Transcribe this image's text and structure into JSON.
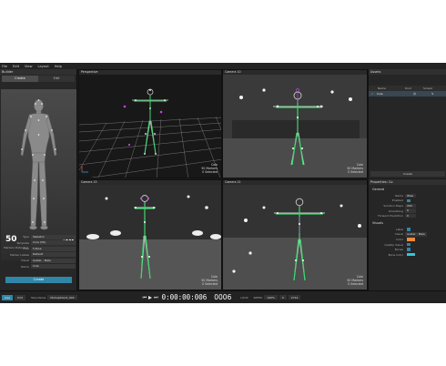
{
  "menu": [
    "File",
    "Edit",
    "View",
    "Layout",
    "Help"
  ],
  "builder": {
    "title": "Builder",
    "tabs": [
      "Create",
      "Edit"
    ],
    "markers_detected": "50",
    "markers_detected_label": "Markers Detected",
    "markers_required": "50",
    "markers_required_label": "Markers Required",
    "properties": [
      {
        "label": "Type",
        "value": "Skeleton"
      },
      {
        "label": "Template",
        "value": "Core (50)"
      },
      {
        "label": "Pose",
        "value": "T-Pose"
      },
      {
        "label": "Marker Labels",
        "value": "Default"
      },
      {
        "label": "Visual",
        "value": "Avatar - Male"
      },
      {
        "label": "Name",
        "value": "Cole"
      }
    ],
    "create_label": "Create"
  },
  "viewports": [
    {
      "title": "Perspective",
      "info": [
        "Cole",
        "50 Markers",
        "0 Selected"
      ]
    },
    {
      "title": "Camera 10",
      "info": [
        "Cole",
        "50 Markers",
        "0 Selected"
      ]
    },
    {
      "title": "Camera 15",
      "info": [
        "Cole",
        "50 Markers",
        "0 Selected"
      ]
    },
    {
      "title": "Camera 21",
      "info": [
        "Cole",
        "50 Markers",
        "0 Selected"
      ]
    }
  ],
  "assets": {
    "title": "Assets",
    "columns": [
      "Name",
      "Kind",
      "Solved"
    ],
    "row": {
      "name": "Cole"
    },
    "create_label": "Create"
  },
  "properties_panel": {
    "title": "Properties: Co",
    "general_label": "General",
    "general": [
      {
        "label": "Name",
        "value": "Wise"
      },
      {
        "label": "Enabled",
        "value": ""
      },
      {
        "label": "Solution Steps",
        "value": "200"
      },
      {
        "label": "Smoothing",
        "value": "0"
      },
      {
        "label": "Forward Prediction",
        "value": "0"
      }
    ],
    "visuals_label": "Visuals",
    "visuals": [
      {
        "label": "Label",
        "value": ""
      },
      {
        "label": "Visual",
        "value": "Avatar - Male"
      },
      {
        "label": "Color",
        "value": ""
      },
      {
        "label": "Quality Visual",
        "value": ""
      },
      {
        "label": "Bones",
        "value": ""
      },
      {
        "label": "Bone Color",
        "value": ""
      }
    ],
    "accent_color": "#f08a3e",
    "bone_color": "#32c6d8"
  },
  "timeline": {
    "mode_live": "Live",
    "mode_edit": "Edit",
    "take_label": "Take Name",
    "take_name": "MoCapShoot_003",
    "timecode": "0:00:00:006",
    "frame": "0006",
    "loop_label": "LOOP",
    "speed_label": "SPEED",
    "speed_value": "100%",
    "start_value": "0",
    "end_value": "2714"
  }
}
